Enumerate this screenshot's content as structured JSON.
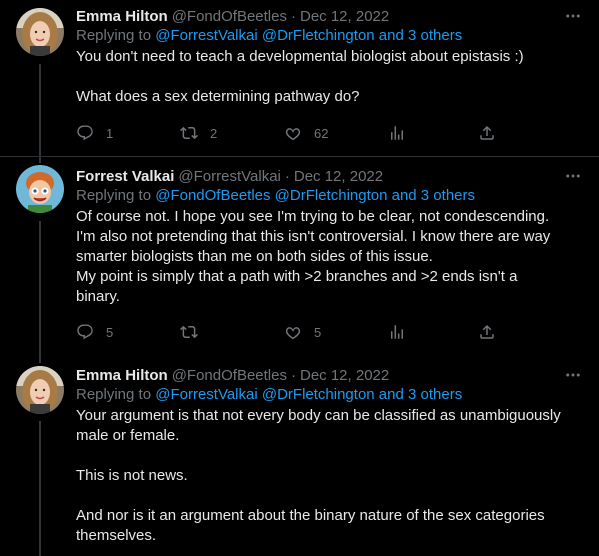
{
  "tweets": [
    {
      "name": "Emma Hilton",
      "handle": "@FondOfBeetles",
      "date": "Dec 12, 2022",
      "replying_prefix": "Replying to",
      "replying_to": "@ForrestValkai @DrFletchington and 3 others",
      "paragraphs": [
        "You don't need to teach a developmental biologist about epistasis :)",
        "What does a sex determining pathway do?"
      ],
      "reply_count": "1",
      "retweet_count": "2",
      "like_count": "62"
    },
    {
      "name": "Forrest Valkai",
      "handle": "@ForrestValkai",
      "date": "Dec 12, 2022",
      "replying_prefix": "Replying to",
      "replying_to": "@FondOfBeetles @DrFletchington and 3 others",
      "lines": [
        "Of course not. I hope you see I'm trying to be clear, not condescending.",
        "I'm also not pretending that this isn't controversial. I know there are way",
        "smarter biologists than me on both sides of this issue.",
        "My point is simply that a path with >2 branches and >2 ends isn't a",
        "binary."
      ],
      "reply_count": "5",
      "retweet_count": "",
      "like_count": "5"
    },
    {
      "name": "Emma Hilton",
      "handle": "@FondOfBeetles",
      "date": "Dec 12, 2022",
      "replying_prefix": "Replying to",
      "replying_to": "@ForrestValkai @DrFletchington and 3 others",
      "lines_a": [
        "Your argument is that not every body can be classified as unambiguously",
        "male or female."
      ],
      "line_b": "This is not news.",
      "lines_c": [
        "And nor is it an argument about the binary nature of the sex categories",
        "themselves."
      ]
    }
  ],
  "separator": "·",
  "colors": {
    "background": "#000000",
    "text": "#e7e9ea",
    "secondary": "#71767b",
    "link": "#1d9bf0",
    "divider": "#2f3336"
  },
  "icons": [
    "more-icon",
    "reply-icon",
    "retweet-icon",
    "like-icon",
    "views-icon",
    "share-icon"
  ]
}
